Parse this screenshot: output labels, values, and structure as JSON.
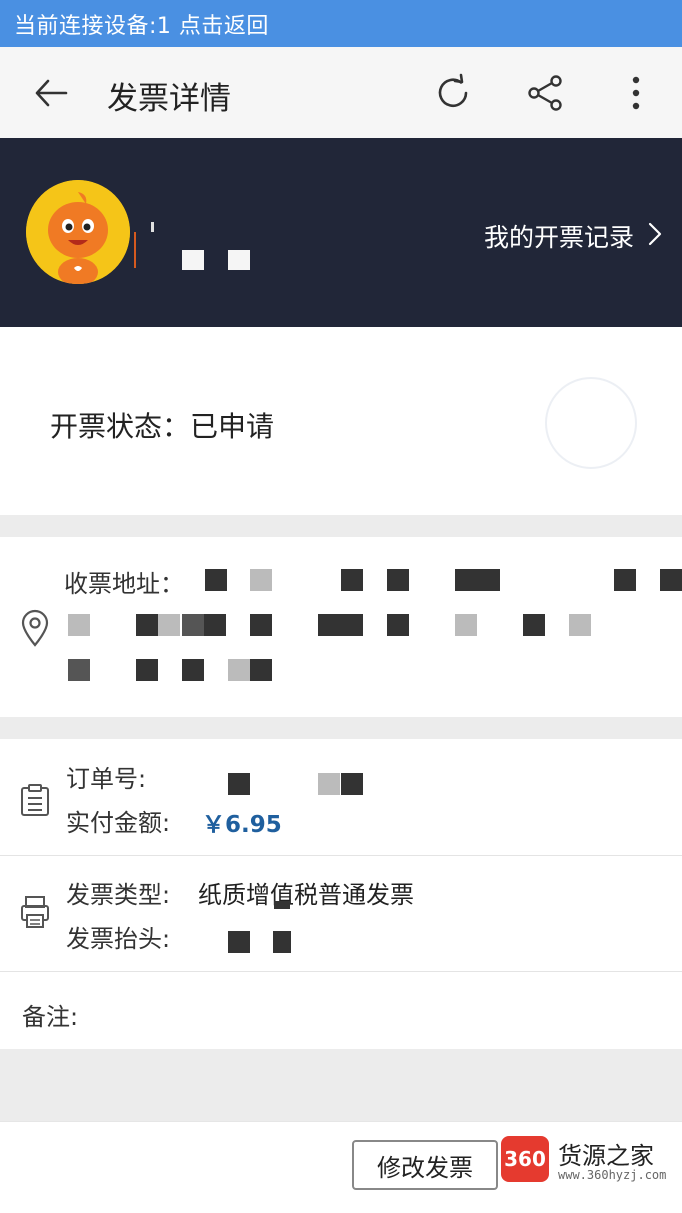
{
  "status_bar": {
    "text": "当前连接设备:1 点击返回"
  },
  "appbar": {
    "title": "发票详情",
    "icons": [
      "back-arrow-icon",
      "refresh-icon",
      "share-icon",
      "more-vertical-icon"
    ]
  },
  "header": {
    "records_link": "我的开票记录",
    "chevron": "›"
  },
  "invoice_status": {
    "text": "开票状态：已申请"
  },
  "address": {
    "label": "收票地址：",
    "icon": "location-pin-icon"
  },
  "order": {
    "order_no_label": "订单号:",
    "paid_label": "实付金额:",
    "paid_value": "￥6.95",
    "icon": "clipboard-icon"
  },
  "invoice": {
    "type_label": "发票类型:",
    "type_value": "纸质增值税普通发票",
    "title_label": "发票抬头:",
    "icon": "printer-icon"
  },
  "remark": {
    "label": "备注:"
  },
  "bottom": {
    "modify_button": "修改发票"
  },
  "watermark": {
    "logo": "360",
    "name": "货源之家",
    "url": "www.360hyzj.com"
  },
  "colors": {
    "status_bar": "#4a90e2",
    "header_bg": "#212638",
    "amount": "#1f5f9e",
    "watermark_red": "#e53a2f"
  }
}
